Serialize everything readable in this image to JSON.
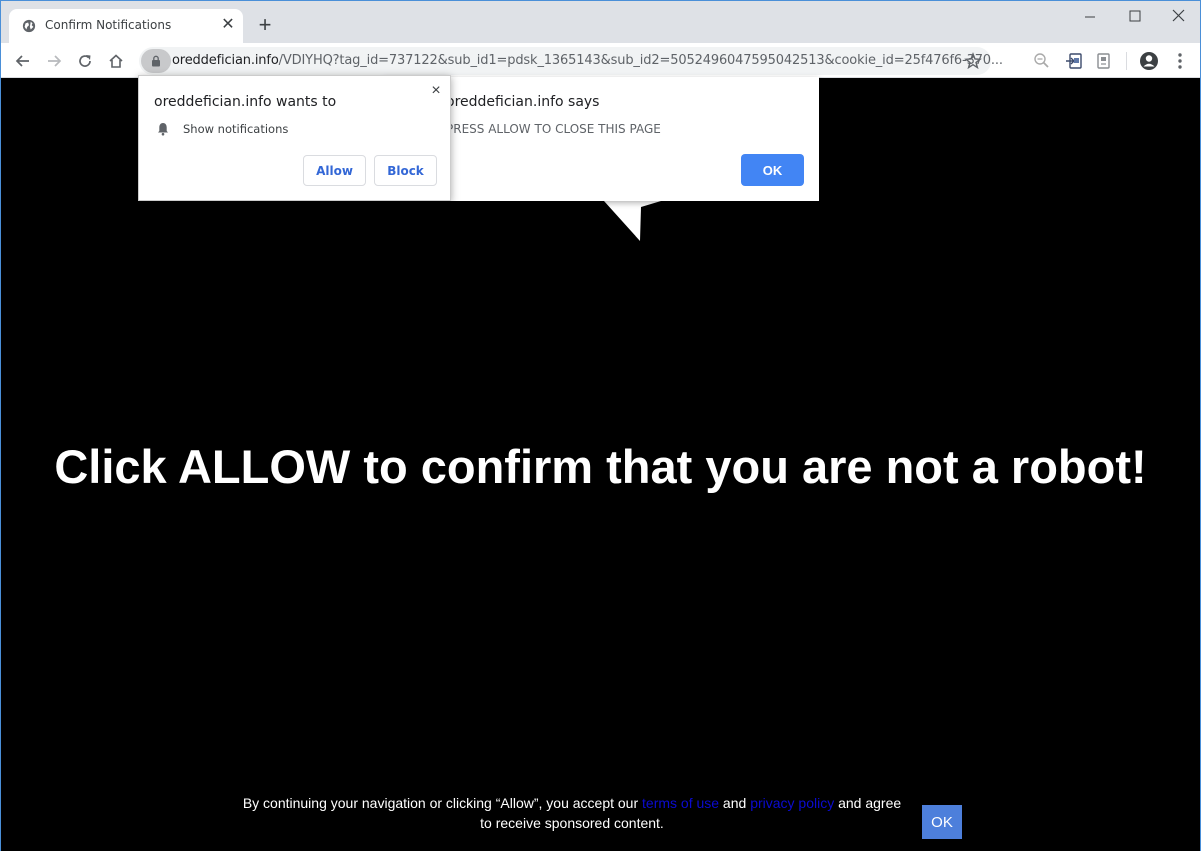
{
  "browser": {
    "tab": {
      "title": "Confirm Notifications",
      "favicon": "globe-icon"
    },
    "new_tab_symbol": "+",
    "window_controls": {
      "minimize": "–",
      "maximize": "□",
      "close": "✕"
    },
    "url": {
      "host": "oreddefician.info",
      "path": "/VDIYHQ?tag_id=737122&sub_id1=pdsk_1365143&sub_id2=5052496047595042513&cookie_id=25f476f6-370..."
    },
    "toolbar_icons": [
      "back-icon",
      "forward-icon",
      "reload-icon",
      "home-icon",
      "lock-icon",
      "star-icon",
      "zoom-icon",
      "extension-icon",
      "extension-icon",
      "profile-icon",
      "menu-icon"
    ]
  },
  "permission_prompt": {
    "title": "oreddefician.info wants to",
    "permission": "Show notifications",
    "allow_label": "Allow",
    "block_label": "Block",
    "close_symbol": "×"
  },
  "alert_dialog": {
    "title": "oreddefician.info says",
    "message": "PRESS ALLOW TO CLOSE THIS PAGE",
    "ok_label": "OK"
  },
  "page": {
    "headline": "Click ALLOW to confirm that you are not a robot!",
    "footer": {
      "text_before": "By continuing your navigation or clicking “Allow”, you accept our ",
      "terms_link": "terms of use",
      "text_middle": " and ",
      "privacy_link": "privacy policy",
      "text_after": " and agree to receive sponsored content.",
      "ok_label": "OK"
    }
  }
}
